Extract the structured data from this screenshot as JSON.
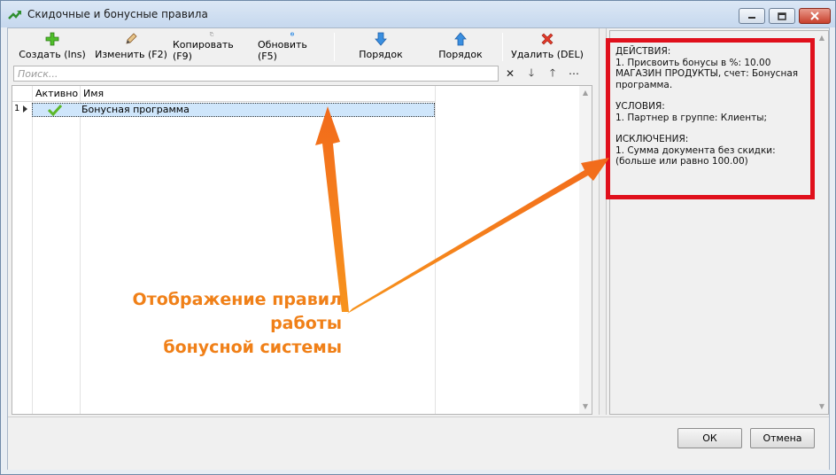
{
  "window": {
    "title": "Скидочные и бонусные правила",
    "minimize_icon": "minimize-icon",
    "maximize_icon": "maximize-icon",
    "close_icon": "close-icon"
  },
  "toolbar": {
    "create_label": "Создать (Ins)",
    "edit_label": "Изменить (F2)",
    "copy_label": "Копировать (F9)",
    "refresh_label": "Обновить (F5)",
    "order_down_label": "Порядок",
    "order_up_label": "Порядок",
    "delete_label": "Удалить (DEL)"
  },
  "search": {
    "placeholder": "Поиск..."
  },
  "grid": {
    "columns": [
      "Активно",
      "Имя"
    ],
    "rows": [
      {
        "num": "1",
        "active": true,
        "name": "Бонусная программа"
      }
    ]
  },
  "details": {
    "actions_header": "ДЕЙСТВИЯ:",
    "actions_text": "1. Присвоить бонусы в %: 10.00 МАГАЗИН ПРОДУКТЫ, счет: Бонусная программа.",
    "conditions_header": "УСЛОВИЯ:",
    "conditions_text": "1. Партнер в группе: Клиенты;",
    "exceptions_header": "ИСКЛЮЧЕНИЯ:",
    "exceptions_text": "1. Сумма документа без скидки: (больше или равно 100.00)"
  },
  "buttons": {
    "ok": "ОК",
    "cancel": "Отмена"
  },
  "annotation": {
    "line1": "Отображение правил работы",
    "line2": "бонусной системы"
  },
  "colors": {
    "highlight_border": "#e0101c",
    "annotation": "#f08018",
    "selection": "#cfe6fb"
  }
}
